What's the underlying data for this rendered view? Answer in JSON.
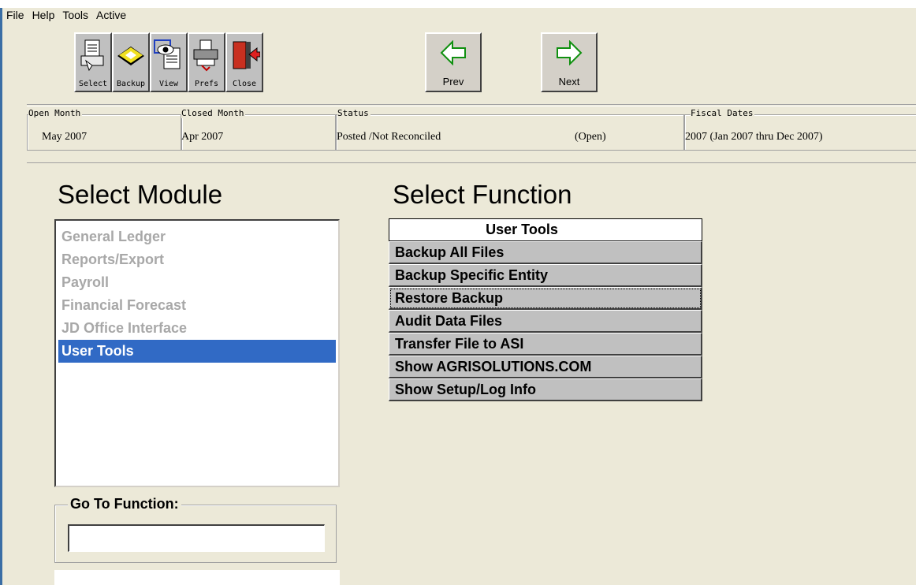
{
  "menu": [
    "File",
    "Help",
    "Tools",
    "Active"
  ],
  "toolbar": {
    "select": "Select",
    "backup": "Backup",
    "view": "View",
    "prefs": "Prefs",
    "close": "Close",
    "prev": "Prev",
    "next": "Next"
  },
  "info": {
    "open_month_label": "Open Month",
    "open_month_value": "May 2007",
    "closed_month_label": "Closed Month",
    "closed_month_value": "Apr 2007",
    "status_label": "Status",
    "status_value": "Posted /Not Reconciled",
    "status_state": "(Open)",
    "fiscal_label": "Fiscal Dates",
    "fiscal_value": "2007 (Jan 2007 thru Dec 2007)"
  },
  "module": {
    "heading": "Select Module",
    "items": [
      "General Ledger",
      "Reports/Export",
      "Payroll",
      "Financial Forecast",
      "JD Office Interface",
      "User Tools"
    ],
    "selected": "User Tools"
  },
  "function": {
    "heading": "Select Function",
    "group": "User Tools",
    "items": [
      "Backup All Files",
      "Backup Specific Entity",
      "Restore Backup",
      "Audit Data Files",
      "Transfer File to ASI",
      "Show AGRISOLUTIONS.COM",
      "Show Setup/Log Info"
    ],
    "focused": "Restore Backup"
  },
  "goto": {
    "label": "Go To Function:",
    "value": ""
  },
  "colors": {
    "selection": "#316ac5",
    "disabled_text": "#a8a8a8",
    "button_face": "#c0c0c0"
  }
}
